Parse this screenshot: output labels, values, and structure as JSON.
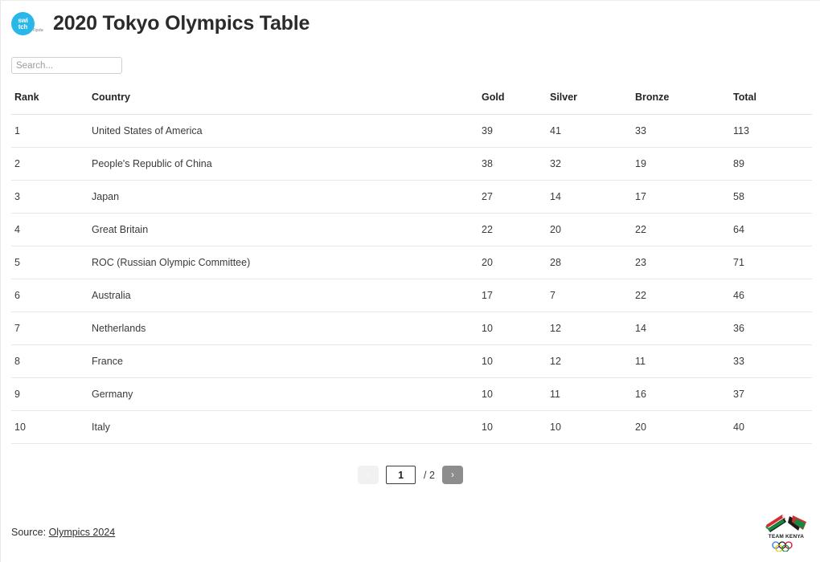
{
  "header": {
    "title": "2020 Tokyo Olympics Table",
    "logo": {
      "icon": "switch-logo-icon",
      "line1": "swi",
      "line2": "tch",
      "sub": "Tipda",
      "color": "#29b6e8"
    }
  },
  "search": {
    "placeholder": "Search...",
    "value": ""
  },
  "table": {
    "columns": [
      "Rank",
      "Country",
      "Gold",
      "Silver",
      "Bronze",
      "Total"
    ],
    "rows": [
      {
        "rank": "1",
        "country": "United States of America",
        "gold": "39",
        "silver": "41",
        "bronze": "33",
        "total": "113"
      },
      {
        "rank": "2",
        "country": "People's Republic of China",
        "gold": "38",
        "silver": "32",
        "bronze": "19",
        "total": "89"
      },
      {
        "rank": "3",
        "country": "Japan",
        "gold": "27",
        "silver": "14",
        "bronze": "17",
        "total": "58"
      },
      {
        "rank": "4",
        "country": "Great Britain",
        "gold": "22",
        "silver": "20",
        "bronze": "22",
        "total": "64"
      },
      {
        "rank": "5",
        "country": "ROC (Russian Olympic Committee)",
        "gold": "20",
        "silver": "28",
        "bronze": "23",
        "total": "71"
      },
      {
        "rank": "6",
        "country": "Australia",
        "gold": "17",
        "silver": "7",
        "bronze": "22",
        "total": "46"
      },
      {
        "rank": "7",
        "country": "Netherlands",
        "gold": "10",
        "silver": "12",
        "bronze": "14",
        "total": "36"
      },
      {
        "rank": "8",
        "country": "France",
        "gold": "10",
        "silver": "12",
        "bronze": "11",
        "total": "33"
      },
      {
        "rank": "9",
        "country": "Germany",
        "gold": "10",
        "silver": "11",
        "bronze": "16",
        "total": "37"
      },
      {
        "rank": "10",
        "country": "Italy",
        "gold": "10",
        "silver": "10",
        "bronze": "20",
        "total": "40"
      }
    ]
  },
  "pagination": {
    "prev_label": "‹",
    "next_label": "›",
    "current_page": "1",
    "total_pages_label": "/ 2",
    "prev_enabled": false,
    "next_enabled": true,
    "prev_color": "#f1f1f1",
    "next_color": "#8d8d8d"
  },
  "footer": {
    "source_prefix": "Source: ",
    "source_link": "Olympics 2024",
    "kenya_logo": {
      "caption": "TEAM KENYA",
      "icon": "team-kenya-logo-icon",
      "colors": {
        "red": "#d32d2f",
        "green": "#138a42",
        "black": "#1a1a1a",
        "white": "#ffffff"
      }
    }
  }
}
